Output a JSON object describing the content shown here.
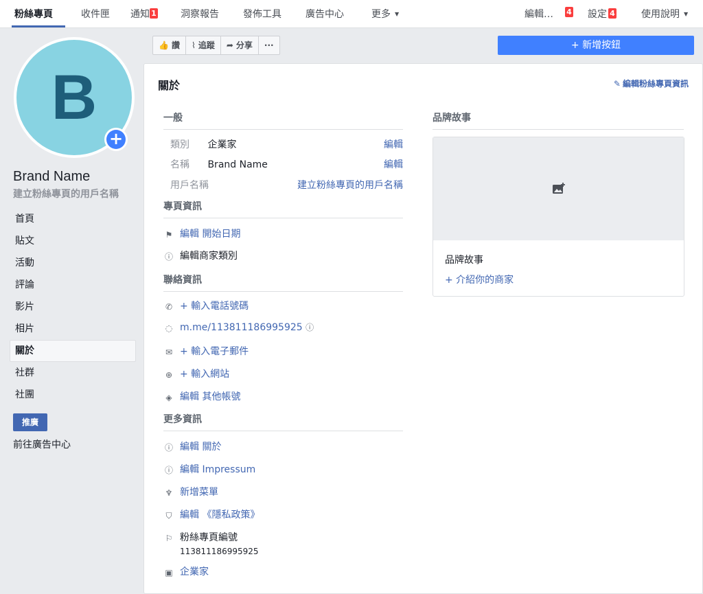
{
  "topnav": {
    "items": [
      "粉絲專頁",
      "收件匣",
      "通知",
      "洞察報告",
      "發佈工具",
      "廣告中心",
      "更多"
    ],
    "notif_badge": "1",
    "right": {
      "edit": "編輯…",
      "edit_badge": "4",
      "settings": "設定",
      "settings_badge": "4",
      "help": "使用說明"
    }
  },
  "profile": {
    "avatar_letter": "B",
    "name": "Brand Name",
    "username_prompt": "建立粉絲專頁的用戶名稱"
  },
  "sidebar": {
    "items": [
      "首頁",
      "貼文",
      "活動",
      "評論",
      "影片",
      "相片",
      "關於",
      "社群",
      "社團"
    ],
    "active_index": 6,
    "promote": "推廣",
    "ads_center": "前往廣告中心"
  },
  "actions": {
    "like": "讚",
    "follow": "追蹤",
    "share": "分享",
    "more": "···",
    "add_button": "+ 新增按鈕"
  },
  "about": {
    "title": "關於",
    "edit_page_info": "編輯粉絲專頁資訊",
    "general": {
      "heading": "一般",
      "rows": [
        {
          "key": "類別",
          "value": "企業家",
          "action": "編輯"
        },
        {
          "key": "名稱",
          "value": "Brand Name",
          "action": "編輯"
        },
        {
          "key": "用戶名稱",
          "value": "",
          "action": "建立粉絲專頁的用戶名稱"
        }
      ]
    },
    "page_info": {
      "heading": "專頁資訊",
      "start_date": "編輯 開始日期",
      "business_category": "編輯商家類別"
    },
    "contact": {
      "heading": "聯絡資訊",
      "phone": "+ 輸入電話號碼",
      "messenger": "m.me/113811186995925",
      "email": "+ 輸入電子郵件",
      "website": "+ 輸入網站",
      "other_accounts": "編輯 其他帳號"
    },
    "more": {
      "heading": "更多資訊",
      "about": "編輯 關於",
      "impressum": "編輯 Impressum",
      "menu": "新增菜單",
      "privacy": "編輯 《隱私政策》",
      "page_id_label": "粉絲專頁編號",
      "page_id": "113811186995925",
      "category": "企業家"
    }
  },
  "brand_story": {
    "heading": "品牌故事",
    "title": "品牌故事",
    "intro": "+ 介紹你的商家"
  },
  "colors": {
    "accent": "#4267b2",
    "button_blue": "#4080ff",
    "badge_red": "#fa3e3e",
    "avatar_bg": "#88d3e2",
    "avatar_letter": "#1e5e7a"
  }
}
